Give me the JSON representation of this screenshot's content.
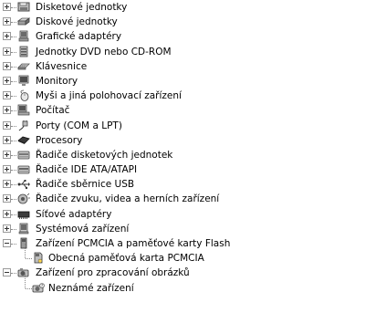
{
  "tree": {
    "items": [
      {
        "label": "Disketové jednotky",
        "icon": "floppy-icon",
        "state": "collapsed"
      },
      {
        "label": "Diskové jednotky",
        "icon": "hard-drive-icon",
        "state": "collapsed"
      },
      {
        "label": "Grafické adaptéry",
        "icon": "display-adapter-icon",
        "state": "collapsed"
      },
      {
        "label": "Jednotky DVD nebo CD-ROM",
        "icon": "cd-drive-icon",
        "state": "collapsed"
      },
      {
        "label": "Klávesnice",
        "icon": "keyboard-icon",
        "state": "collapsed"
      },
      {
        "label": "Monitory",
        "icon": "monitor-icon",
        "state": "collapsed"
      },
      {
        "label": "Myši a jiná polohovací zařízení",
        "icon": "mouse-icon",
        "state": "collapsed"
      },
      {
        "label": "Počítač",
        "icon": "computer-icon",
        "state": "collapsed"
      },
      {
        "label": "Porty (COM a LPT)",
        "icon": "port-icon",
        "state": "collapsed"
      },
      {
        "label": "Procesory",
        "icon": "processor-icon",
        "state": "collapsed"
      },
      {
        "label": "Řadiče disketových jednotek",
        "icon": "floppy-controller-icon",
        "state": "collapsed"
      },
      {
        "label": "Řadiče IDE ATA/ATAPI",
        "icon": "ide-controller-icon",
        "state": "collapsed"
      },
      {
        "label": "Řadiče sběrnice USB",
        "icon": "usb-icon",
        "state": "collapsed"
      },
      {
        "label": "Řadiče zvuku, videa a herních zařízení",
        "icon": "sound-icon",
        "state": "collapsed"
      },
      {
        "label": "Síťové adaptéry",
        "icon": "network-adapter-icon",
        "state": "collapsed"
      },
      {
        "label": "Systémová zařízení",
        "icon": "system-device-icon",
        "state": "collapsed"
      },
      {
        "label": "Zařízení PCMCIA a paměťové karty Flash",
        "icon": "pcmcia-icon",
        "state": "expanded"
      },
      {
        "label": "Obecná paměťová karta PCMCIA",
        "icon": "memory-card-icon",
        "state": "child"
      },
      {
        "label": "Zařízení pro zpracování obrázků",
        "icon": "imaging-device-icon",
        "state": "expanded"
      },
      {
        "label": "Neznámé zařízení",
        "icon": "unknown-device-icon",
        "state": "child"
      }
    ]
  }
}
